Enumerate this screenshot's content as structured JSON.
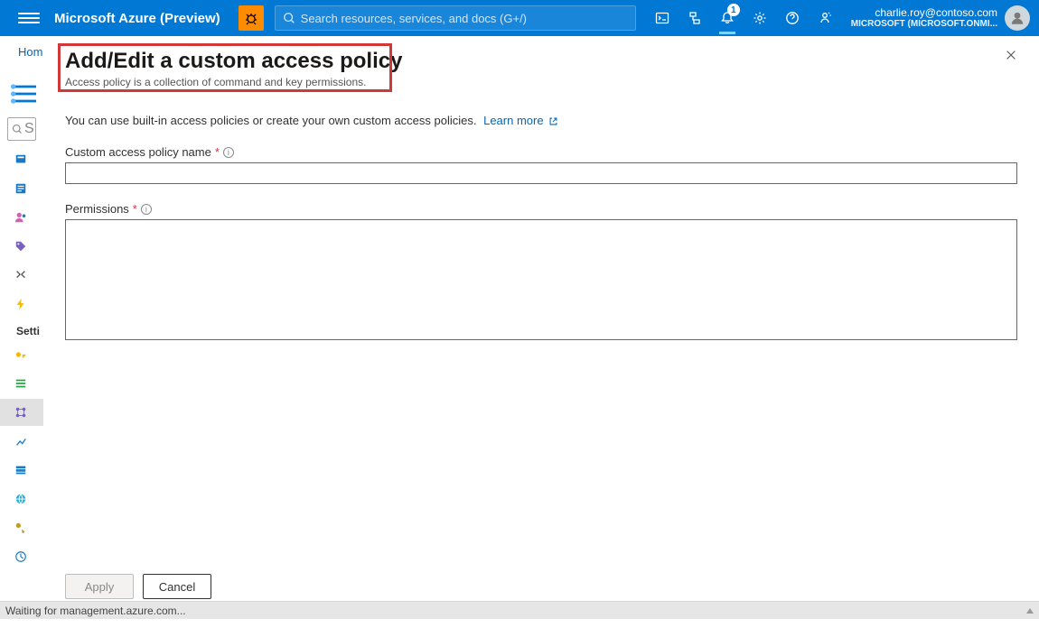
{
  "header": {
    "brand": "Microsoft Azure (Preview)",
    "search_placeholder": "Search resources, services, and docs (G+/)",
    "notification_count": "1",
    "account_email": "charlie.roy@contoso.com",
    "account_tenant": "MICROSOFT (MICROSOFT.ONMI..."
  },
  "breadcrumb": {
    "home": "Hom"
  },
  "sidebar": {
    "settings_header": "Setti",
    "search_placeholder": "S"
  },
  "blade": {
    "title": "Add/Edit a custom access policy",
    "subtitle": "Access policy is a collection of command and key permissions.",
    "intro": "You can use built-in access policies or create your own custom access policies.",
    "learn_more": "Learn more",
    "name_label": "Custom access policy name",
    "name_value": "",
    "permissions_label": "Permissions",
    "permissions_value": "",
    "apply_label": "Apply",
    "cancel_label": "Cancel"
  },
  "statusbar": {
    "message": "Waiting for management.azure.com..."
  }
}
